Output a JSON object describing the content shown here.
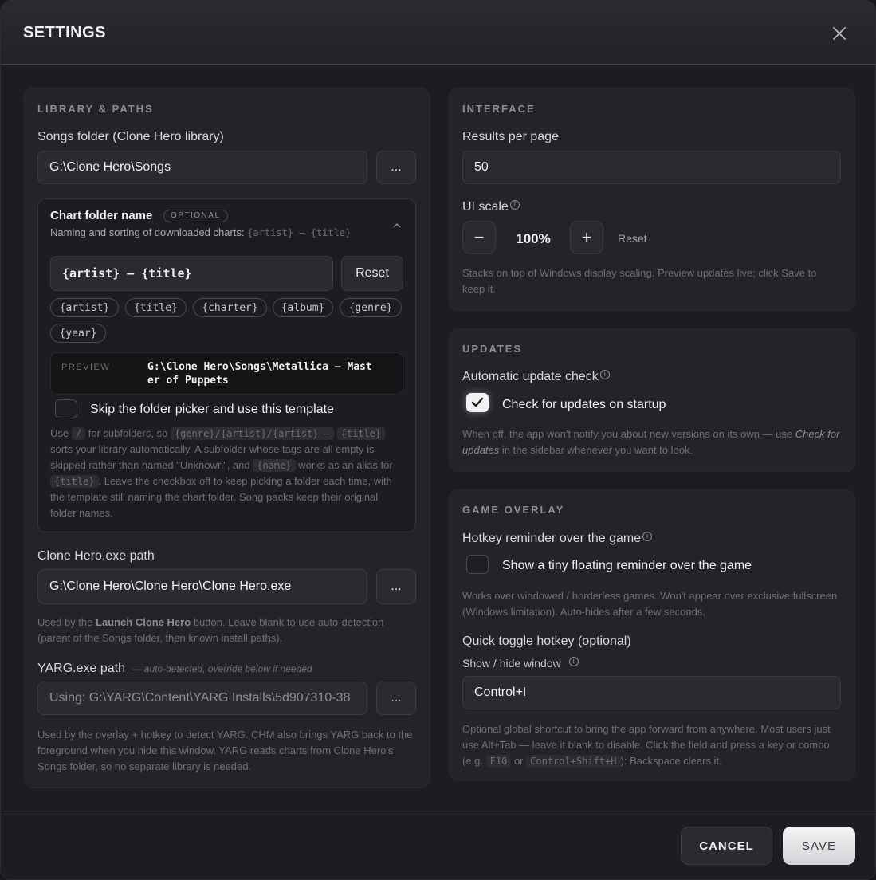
{
  "header": {
    "title": "SETTINGS"
  },
  "library": {
    "section_title": "LIBRARY & PATHS",
    "songs_folder_label": "Songs folder (Clone Hero library)",
    "songs_folder_value": "G:\\Clone Hero\\Songs",
    "browse_label": "...",
    "chart_folder": {
      "title": "Chart folder name",
      "badge": "OPTIONAL",
      "subtitle": "Naming and sorting of downloaded charts:",
      "subtitle_code": "{artist} – {title}",
      "template_value": "{artist} – {title}",
      "reset_label": "Reset",
      "tokens": [
        "{artist}",
        "{title}",
        "{charter}",
        "{album}",
        "{genre}",
        "{year}"
      ],
      "preview_label": "PREVIEW",
      "preview_line1": "G:\\Clone Hero\\Songs\\Metallica – Mast",
      "preview_line2": "er of Puppets",
      "skip_label": "Skip the folder picker and use this template",
      "help": {
        "t1": "Use",
        "c1": "/",
        "t2": "for subfolders, so",
        "c2": "{genre}/{artist}/{artist} –",
        "c3": "{title}",
        "t3": "sorts your library automatically. A subfolder whose tags are all empty is skipped rather than named \"Unknown\", and",
        "c4": "{name}",
        "t4": "works as an alias for",
        "c5": "{title}",
        "t5": ". Leave the checkbox off to keep picking a folder each time, with the template still naming the chart folder. Song packs keep their original folder names."
      }
    },
    "exe_label": "Clone Hero.exe path",
    "exe_value": "G:\\Clone Hero\\Clone Hero\\Clone Hero.exe",
    "exe_help_1": "Used by the",
    "exe_help_bold": "Launch Clone Hero",
    "exe_help_2": "button. Leave blank to use auto-detection (parent of the Songs folder, then known install paths).",
    "yarg_label": "YARG.exe path",
    "yarg_note": "— auto-detected, override below if needed",
    "yarg_placeholder": "Using: G:\\YARG\\Content\\YARG Installs\\5d907310-38",
    "yarg_help": "Used by the overlay + hotkey to detect YARG. CHM also brings YARG back to the foreground when you hide this window. YARG reads charts from Clone Hero's Songs folder, so no separate library is needed."
  },
  "interface": {
    "section_title": "INTERFACE",
    "results_label": "Results per page",
    "results_value": "50",
    "scale_label": "UI scale",
    "minus": "−",
    "scale_value": "100%",
    "plus": "+",
    "reset_label": "Reset",
    "help": "Stacks on top of Windows display scaling. Preview updates live; click Save to keep it."
  },
  "updates": {
    "section_title": "UPDATES",
    "auto_label": "Automatic update check",
    "check_label": "Check for updates on startup",
    "check_state": true,
    "help_1": "When off, the app won't notify you about new versions on its own — use",
    "help_link": "Check for updates",
    "help_2": "in the sidebar whenever you want to look."
  },
  "overlay": {
    "section_title": "GAME OVERLAY",
    "reminder_label": "Hotkey reminder over the game",
    "reminder_check_label": "Show a tiny floating reminder over the game",
    "reminder_state": false,
    "reminder_help": "Works over windowed / borderless games. Won't appear over exclusive fullscreen (Windows limitation). Auto-hides after a few seconds.",
    "hotkey_label": "Quick toggle hotkey (optional)",
    "hotkey_sublabel": "Show / hide window",
    "hotkey_value": "Control+I",
    "hotkey_help_1": "Optional global shortcut to bring the app forward from anywhere. Most users just use Alt+Tab — leave it blank to disable. Click the field and press a key or combo (e.g.",
    "hotkey_code_1": "F10",
    "hotkey_help_2": "or",
    "hotkey_code_2": "Control+Shift+H",
    "hotkey_help_3": "): Backspace clears it."
  },
  "footer": {
    "cancel_label": "CANCEL",
    "save_label": "SAVE"
  }
}
